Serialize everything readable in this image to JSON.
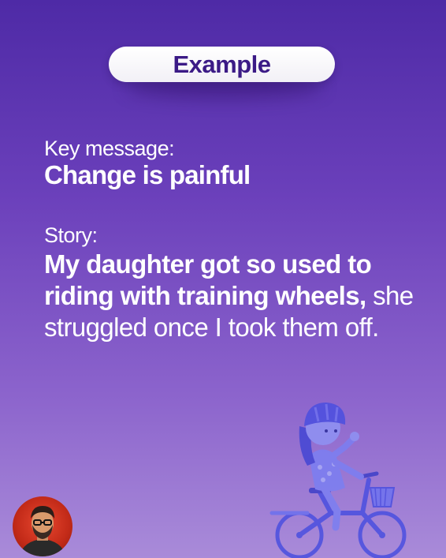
{
  "header": {
    "pill_label": "Example"
  },
  "content": {
    "key_message_label": "Key message:",
    "key_message": "Change is painful",
    "story_label": "Story:",
    "story_bold": "My daughter got so used to riding with training wheels,",
    "story_rest": "she struggled once I took them off."
  },
  "icons": {
    "avatar": "person-avatar",
    "illustration": "girl-on-bicycle-illustration"
  },
  "colors": {
    "background_top": "#4e2aa6",
    "background_bottom": "#a98bd9",
    "pill_text": "#3b1a86",
    "text": "#ffffff",
    "illustration_blue": "#5a5ee6",
    "avatar_red": "#d03a24"
  }
}
